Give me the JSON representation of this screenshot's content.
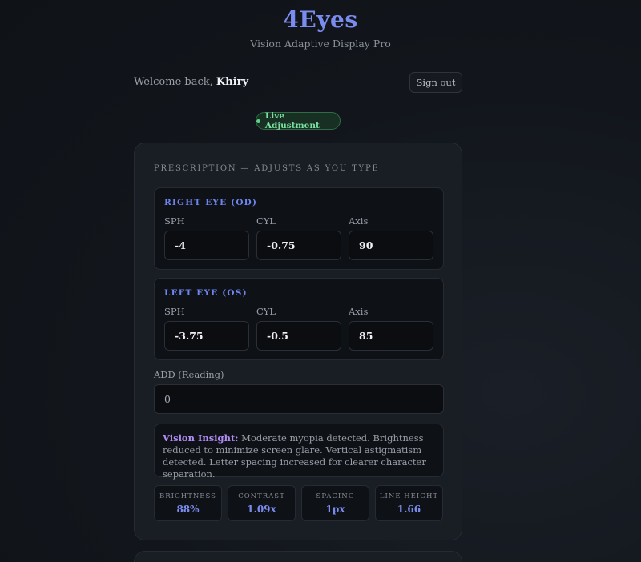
{
  "header": {
    "title": "4Eyes",
    "subtitle": "Vision Adaptive Display Pro"
  },
  "user": {
    "welcome_prefix": "Welcome back,",
    "name": "Khiry",
    "signout_label": "Sign out"
  },
  "status": {
    "live_label": "Live Adjustment",
    "color": "#5fd38a"
  },
  "prescription": {
    "section_title": "Prescription — adjusts as you type",
    "right_eye": {
      "title": "Right Eye (OD)",
      "sph_label": "SPH",
      "sph": "-4",
      "cyl_label": "CYL",
      "cyl": "-0.75",
      "axis_label": "Axis",
      "axis": "90"
    },
    "left_eye": {
      "title": "Left Eye (OS)",
      "sph_label": "SPH",
      "sph": "-3.75",
      "cyl_label": "CYL",
      "cyl": "-0.5",
      "axis_label": "Axis",
      "axis": "85"
    },
    "add_label": "ADD (Reading)",
    "add_value": "0"
  },
  "insight": {
    "label": "Vision Insight:",
    "text": "Moderate myopia detected. Brightness reduced to minimize screen glare. Vertical astigmatism detected. Letter spacing increased for clearer character separation."
  },
  "metrics": [
    {
      "label": "Brightness",
      "value": "88%"
    },
    {
      "label": "Contrast",
      "value": "1.09x"
    },
    {
      "label": "Spacing",
      "value": "1px"
    },
    {
      "label": "Line Height",
      "value": "1.66"
    }
  ],
  "colors": {
    "accent": "#7b8cf0",
    "insight_accent": "#b08cf5",
    "live_green": "#7ee0a0"
  }
}
